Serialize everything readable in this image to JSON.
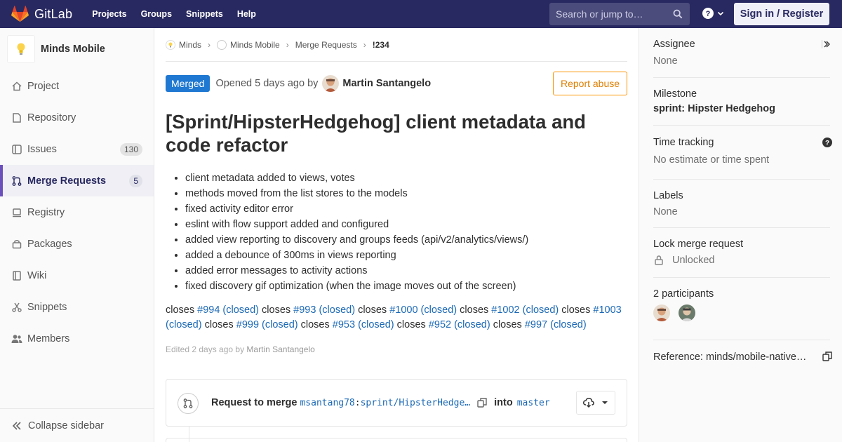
{
  "topbar": {
    "brand": "GitLab",
    "nav": [
      "Projects",
      "Groups",
      "Snippets",
      "Help"
    ],
    "search_placeholder": "Search or jump to…",
    "signin_label": "Sign in / Register",
    "colors": {
      "bg": "#292961",
      "accent": "#fc6d26"
    }
  },
  "sidebar": {
    "project_name": "Minds Mobile",
    "items": [
      {
        "label": "Project",
        "icon": "home-icon"
      },
      {
        "label": "Repository",
        "icon": "doc-icon"
      },
      {
        "label": "Issues",
        "icon": "issues-icon",
        "count": "130"
      },
      {
        "label": "Merge Requests",
        "icon": "merge-request-icon",
        "count": "5",
        "active": true
      },
      {
        "label": "Registry",
        "icon": "container-icon"
      },
      {
        "label": "Packages",
        "icon": "package-icon"
      },
      {
        "label": "Wiki",
        "icon": "book-icon"
      },
      {
        "label": "Snippets",
        "icon": "scissors-icon"
      },
      {
        "label": "Members",
        "icon": "users-icon"
      }
    ],
    "collapse_label": "Collapse sidebar"
  },
  "breadcrumb": {
    "items": [
      "Minds",
      "Minds Mobile",
      "Merge Requests"
    ],
    "current": "!234"
  },
  "mr": {
    "status": "Merged",
    "opened_text": "Opened 5 days ago by",
    "author": "Martin Santangelo",
    "report_label": "Report abuse",
    "title": "[Sprint/HipsterHedgehog] client metadata and code refactor",
    "description": [
      "client metadata added to views, votes",
      "methods moved from the list stores to the models",
      "fixed activity editor error",
      "eslint with flow support added and configured",
      "added view reporting to discovery and groups feeds (api/v2/analytics/views/)",
      "added a debounce of 300ms in views reporting",
      "added error messages to activity actions",
      "fixed discovery gif optimization (when the image moves out of the screen)"
    ],
    "closes_word": "closes",
    "closes": [
      "#994 (closed)",
      "#993 (closed)",
      "#1000 (closed)",
      "#1002 (closed)",
      "#1003 (closed)",
      "#999 (closed)",
      "#953 (closed)",
      "#952 (closed)",
      "#997 (closed)"
    ],
    "edited_prefix": "Edited 2 days ago by",
    "edited_by": "Martin Santangelo",
    "request_to_merge": "Request to merge",
    "source_user": "msantang78",
    "source_branch": "sprint/HipsterHedge…",
    "into": "into",
    "target_branch": "master"
  },
  "rightsidebar": {
    "assignee_label": "Assignee",
    "assignee_value": "None",
    "milestone_label": "Milestone",
    "milestone_value": "sprint: Hipster Hedgehog",
    "time_label": "Time tracking",
    "time_value": "No estimate or time spent",
    "labels_label": "Labels",
    "labels_value": "None",
    "lock_label": "Lock merge request",
    "lock_value": "Unlocked",
    "participants_label": "2 participants",
    "reference": "Reference: minds/mobile-native…"
  }
}
